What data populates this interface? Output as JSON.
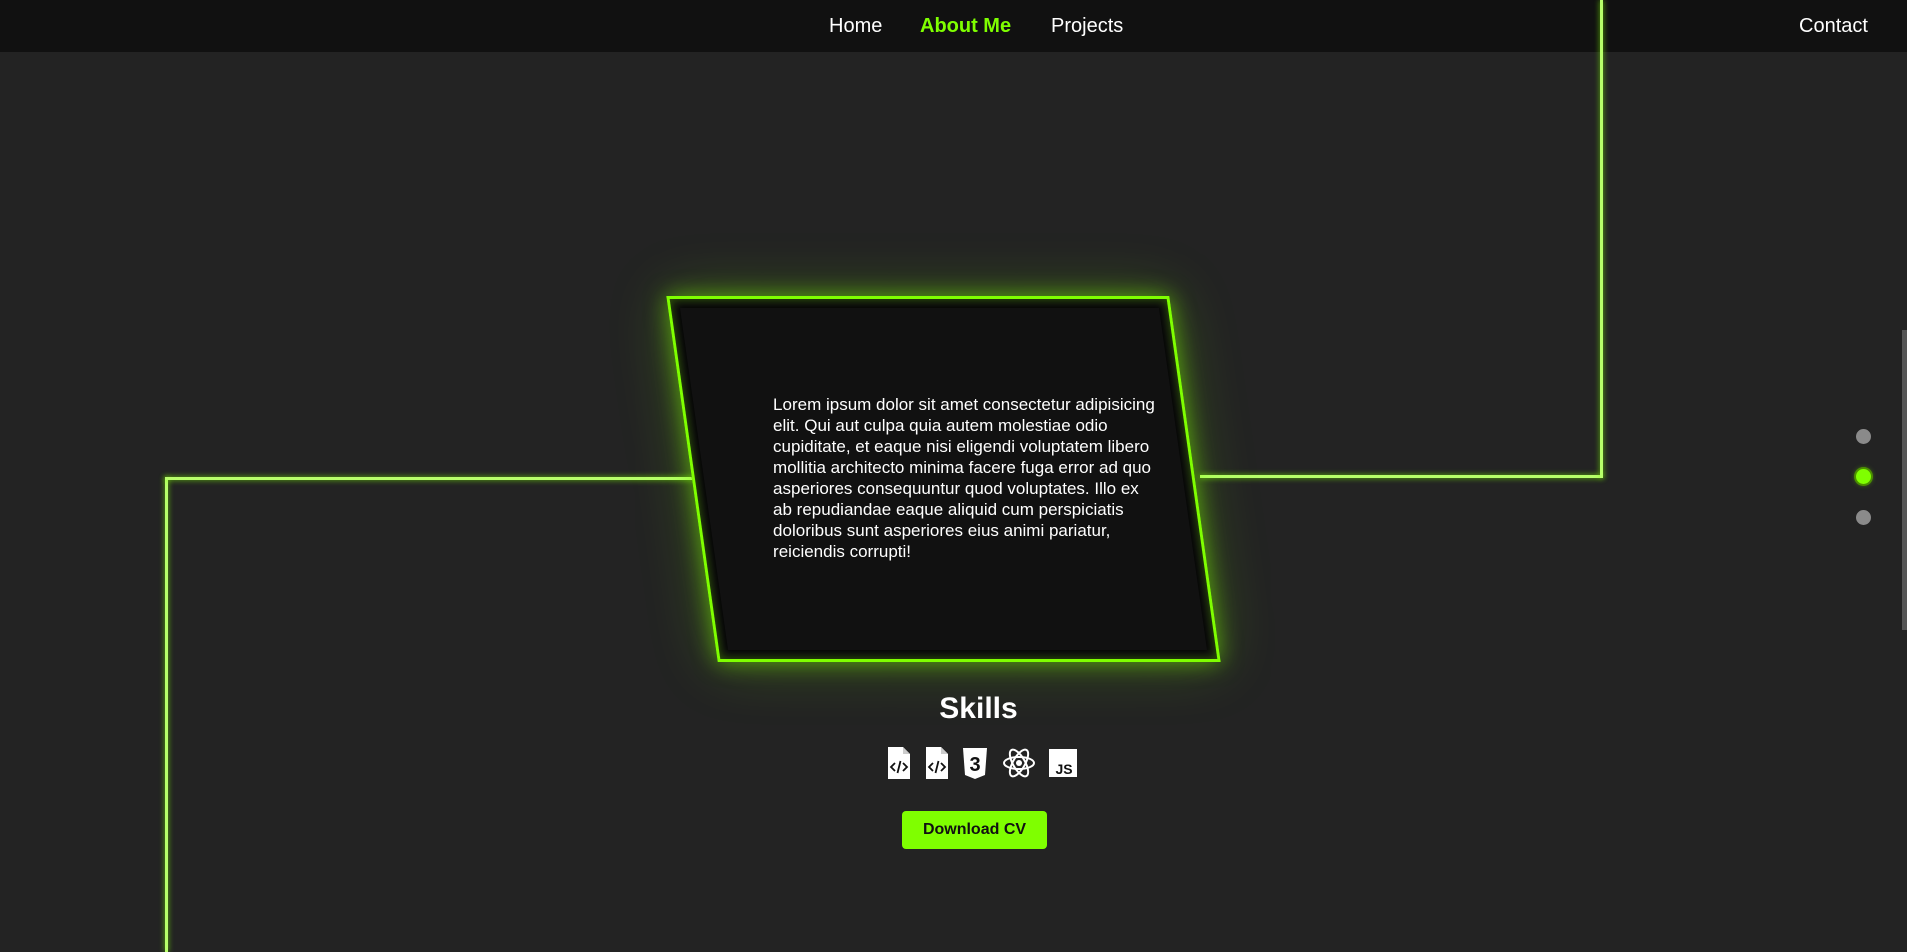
{
  "nav": {
    "home": "Home",
    "about": "About Me",
    "projects": "Projects",
    "contact": "Contact"
  },
  "about": {
    "text": "Lorem ipsum dolor sit amet consectetur adipisicing elit. Qui aut culpa quia autem molestiae odio cupiditate, et eaque nisi eligendi voluptatem libero mollitia architecto minima facere fuga error ad quo asperiores consequuntur quod voluptates. Illo ex ab repudiandae eaque aliquid cum perspiciatis doloribus sunt asperiores eius animi pariatur, reiciendis corrupti!"
  },
  "skills": {
    "title": "Skills",
    "icons": [
      "html-file-icon",
      "code-file-icon",
      "css3-icon",
      "react-icon",
      "javascript-icon"
    ],
    "js_badge": "JS",
    "css_badge": "3"
  },
  "cv_button": {
    "label": "Download CV"
  },
  "section_dots": {
    "count": 3,
    "active_index": 1
  },
  "colors": {
    "accent": "#7fff00",
    "background": "#232323",
    "navbar": "#111111",
    "card": "#111111",
    "line": "#b7ff6a",
    "dot_inactive": "#8a8a8a"
  }
}
